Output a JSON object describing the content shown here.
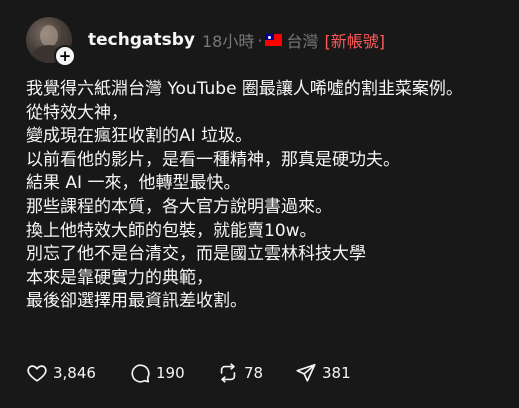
{
  "post": {
    "username": "techgatsby",
    "time": "18小時",
    "separator": "·",
    "location": "台灣",
    "tag": "[新帳號]",
    "follow_symbol": "+",
    "flag_icon": "taiwan-flag-icon",
    "lines": [
      "我覺得六紙淵台灣 YouTube 圈最讓人唏噓的割韭菜案例。",
      "從特效大神，",
      "變成現在瘋狂收割的AI 垃圾。",
      "以前看他的影片，是看一種精神，那真是硬功夫。",
      "結果 AI 一來，他轉型最快。",
      "那些課程的本質，各大官方說明書過來。",
      "換上他特效大師的包裝，就能賣10w。",
      "別忘了他不是台清交，而是國立雲林科技大學",
      "本來是靠硬實力的典範，",
      "最後卻選擇用最資訊差收割。"
    ],
    "actions": {
      "likes": "3,846",
      "comments": "190",
      "reposts": "78",
      "shares": "381"
    }
  },
  "colors": {
    "background": "#181818",
    "text": "#f3f5f7",
    "muted": "#777777",
    "tag": "#ff5a5a"
  }
}
